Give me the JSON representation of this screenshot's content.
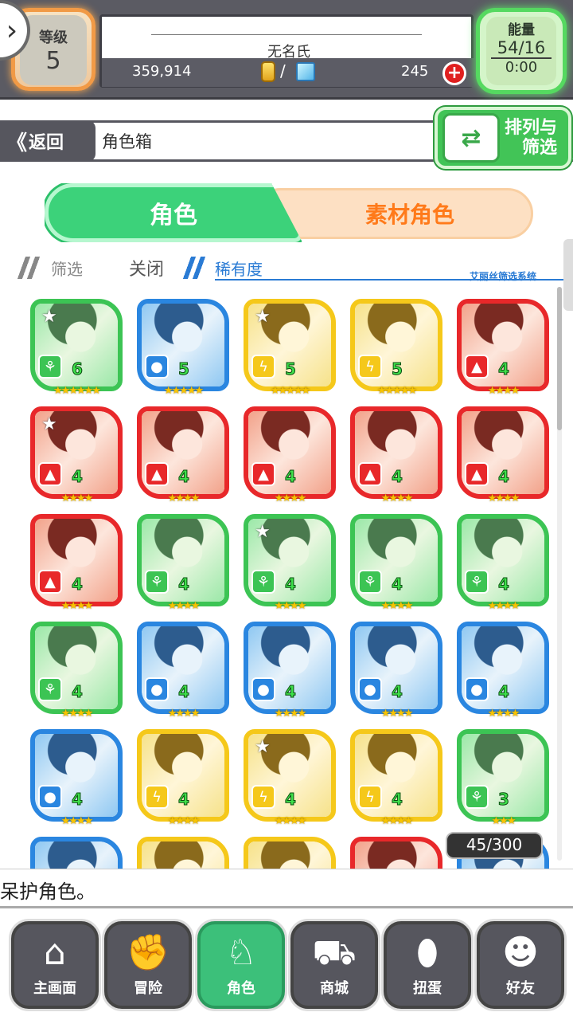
{
  "header": {
    "level_label": "等级",
    "level_value": "5",
    "player_name": "无名氏",
    "gold": "359,914",
    "slash": "/",
    "gems": "245",
    "plus": "+",
    "energy_label": "能量",
    "energy_value": "54/16",
    "energy_timer": "0:00",
    "menu_glyph": "›"
  },
  "nav_back": {
    "back_label": "返回",
    "back_glyph": "《",
    "title": "角色箱",
    "sort_label": "排列与筛选"
  },
  "tabs": [
    {
      "label": "角色"
    },
    {
      "label": "素材角色"
    }
  ],
  "filter": {
    "label": "筛选",
    "toggle": "关闭",
    "rarity": "稀有度",
    "system": "艾丽丝筛选系统"
  },
  "colors": {
    "green": "#3cc454",
    "blue": "#2a86e0",
    "yellow": "#f5c81a",
    "red": "#e8282a"
  },
  "cards": [
    {
      "element": "green",
      "icon": "leaf-icon",
      "level": "6",
      "stars": "★★★★★★",
      "fav": true
    },
    {
      "element": "blue",
      "icon": "water-icon",
      "level": "5",
      "stars": "★★★★★",
      "fav": false
    },
    {
      "element": "yellow",
      "icon": "thunder-icon",
      "level": "5",
      "stars": "★★★★★",
      "fav": true
    },
    {
      "element": "yellow",
      "icon": "thunder-icon",
      "level": "5",
      "stars": "★★★★★",
      "fav": false
    },
    {
      "element": "red",
      "icon": "fire-icon",
      "level": "4",
      "stars": "★★★★",
      "fav": false
    },
    {
      "element": "red",
      "icon": "fire-icon",
      "level": "4",
      "stars": "★★★★",
      "fav": true
    },
    {
      "element": "red",
      "icon": "fire-icon",
      "level": "4",
      "stars": "★★★★",
      "fav": false
    },
    {
      "element": "red",
      "icon": "fire-icon",
      "level": "4",
      "stars": "★★★★",
      "fav": false
    },
    {
      "element": "red",
      "icon": "fire-icon",
      "level": "4",
      "stars": "★★★★",
      "fav": false
    },
    {
      "element": "red",
      "icon": "fire-icon",
      "level": "4",
      "stars": "★★★★",
      "fav": false
    },
    {
      "element": "red",
      "icon": "fire-icon",
      "level": "4",
      "stars": "★★★★",
      "fav": false
    },
    {
      "element": "green",
      "icon": "leaf-icon",
      "level": "4",
      "stars": "★★★★",
      "fav": false
    },
    {
      "element": "green",
      "icon": "leaf-icon",
      "level": "4",
      "stars": "★★★★",
      "fav": true
    },
    {
      "element": "green",
      "icon": "leaf-icon",
      "level": "4",
      "stars": "★★★★",
      "fav": false
    },
    {
      "element": "green",
      "icon": "leaf-icon",
      "level": "4",
      "stars": "★★★★",
      "fav": false
    },
    {
      "element": "green",
      "icon": "leaf-icon",
      "level": "4",
      "stars": "★★★★",
      "fav": false
    },
    {
      "element": "blue",
      "icon": "water-icon",
      "level": "4",
      "stars": "★★★★",
      "fav": false
    },
    {
      "element": "blue",
      "icon": "water-icon",
      "level": "4",
      "stars": "★★★★",
      "fav": false
    },
    {
      "element": "blue",
      "icon": "water-icon",
      "level": "4",
      "stars": "★★★★",
      "fav": false
    },
    {
      "element": "blue",
      "icon": "water-icon",
      "level": "4",
      "stars": "★★★★",
      "fav": false
    },
    {
      "element": "blue",
      "icon": "water-icon",
      "level": "4",
      "stars": "★★★★",
      "fav": false
    },
    {
      "element": "yellow",
      "icon": "thunder-icon",
      "level": "4",
      "stars": "★★★★",
      "fav": false
    },
    {
      "element": "yellow",
      "icon": "thunder-icon",
      "level": "4",
      "stars": "★★★★",
      "fav": true
    },
    {
      "element": "yellow",
      "icon": "thunder-icon",
      "level": "4",
      "stars": "★★★★",
      "fav": false
    },
    {
      "element": "green",
      "icon": "leaf-icon",
      "level": "3",
      "stars": "★★★",
      "fav": false
    },
    {
      "element": "blue",
      "icon": "water-icon",
      "level": "",
      "stars": "",
      "fav": false
    },
    {
      "element": "yellow",
      "icon": "thunder-icon",
      "level": "",
      "stars": "",
      "fav": false
    },
    {
      "element": "yellow",
      "icon": "thunder-icon",
      "level": "",
      "stars": "",
      "fav": false
    },
    {
      "element": "red",
      "icon": "fire-icon",
      "level": "",
      "stars": "",
      "fav": false
    },
    {
      "element": "blue",
      "icon": "water-icon",
      "level": "",
      "stars": "",
      "fav": false
    }
  ],
  "box_count": "45/300",
  "hint": "呆护角色。",
  "bottom_nav": [
    {
      "label": "主画面",
      "icon": "home-icon",
      "glyph": "⌂",
      "active": false
    },
    {
      "label": "冒险",
      "icon": "handshake-icon",
      "glyph": "✊",
      "active": false
    },
    {
      "label": "角色",
      "icon": "bunny-icon",
      "glyph": "♘",
      "active": true
    },
    {
      "label": "商城",
      "icon": "cart-icon",
      "glyph": "⛟",
      "active": false
    },
    {
      "label": "扭蛋",
      "icon": "egg-icon",
      "glyph": "⬮",
      "active": false
    },
    {
      "label": "好友",
      "icon": "friends-icon",
      "glyph": "☻",
      "active": false
    }
  ]
}
